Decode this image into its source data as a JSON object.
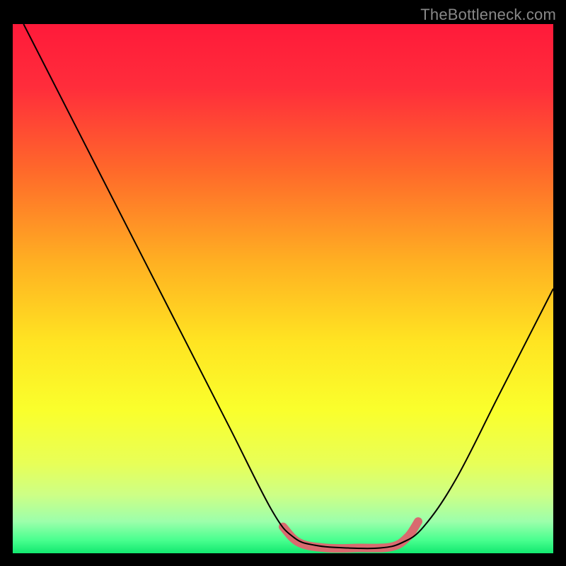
{
  "attribution": "TheBottleneck.com",
  "chart_data": {
    "type": "line",
    "title": "",
    "xlabel": "",
    "ylabel": "",
    "xlim": [
      0,
      100
    ],
    "ylim": [
      0,
      100
    ],
    "background_gradient": {
      "stops": [
        {
          "offset": 0.0,
          "color": "#ff1a3a"
        },
        {
          "offset": 0.12,
          "color": "#ff2d3b"
        },
        {
          "offset": 0.28,
          "color": "#ff6a2a"
        },
        {
          "offset": 0.45,
          "color": "#ffb022"
        },
        {
          "offset": 0.6,
          "color": "#ffe422"
        },
        {
          "offset": 0.73,
          "color": "#faff2c"
        },
        {
          "offset": 0.83,
          "color": "#e8ff57"
        },
        {
          "offset": 0.89,
          "color": "#cdff86"
        },
        {
          "offset": 0.94,
          "color": "#9cffab"
        },
        {
          "offset": 0.975,
          "color": "#49ff8f"
        },
        {
          "offset": 1.0,
          "color": "#12e86f"
        }
      ]
    },
    "series": [
      {
        "name": "bottleneck-curve",
        "stroke": "#000000",
        "stroke_width": 2,
        "points": [
          {
            "x": 2.0,
            "y": 100.0
          },
          {
            "x": 10.0,
            "y": 84.0
          },
          {
            "x": 20.0,
            "y": 64.0
          },
          {
            "x": 30.0,
            "y": 44.0
          },
          {
            "x": 40.0,
            "y": 24.0
          },
          {
            "x": 48.0,
            "y": 8.0
          },
          {
            "x": 52.0,
            "y": 3.0
          },
          {
            "x": 56.0,
            "y": 1.5
          },
          {
            "x": 62.0,
            "y": 1.0
          },
          {
            "x": 68.0,
            "y": 1.0
          },
          {
            "x": 72.0,
            "y": 2.0
          },
          {
            "x": 76.0,
            "y": 5.0
          },
          {
            "x": 82.0,
            "y": 14.0
          },
          {
            "x": 90.0,
            "y": 30.0
          },
          {
            "x": 100.0,
            "y": 50.0
          }
        ]
      },
      {
        "name": "optimal-range-marker",
        "stroke": "#d96a6f",
        "stroke_width": 12,
        "linecap": "round",
        "points": [
          {
            "x": 50.0,
            "y": 5.0
          },
          {
            "x": 53.0,
            "y": 2.0
          },
          {
            "x": 58.0,
            "y": 1.0
          },
          {
            "x": 64.0,
            "y": 1.0
          },
          {
            "x": 70.0,
            "y": 1.2
          },
          {
            "x": 73.0,
            "y": 3.0
          },
          {
            "x": 75.0,
            "y": 6.0
          }
        ]
      }
    ]
  }
}
